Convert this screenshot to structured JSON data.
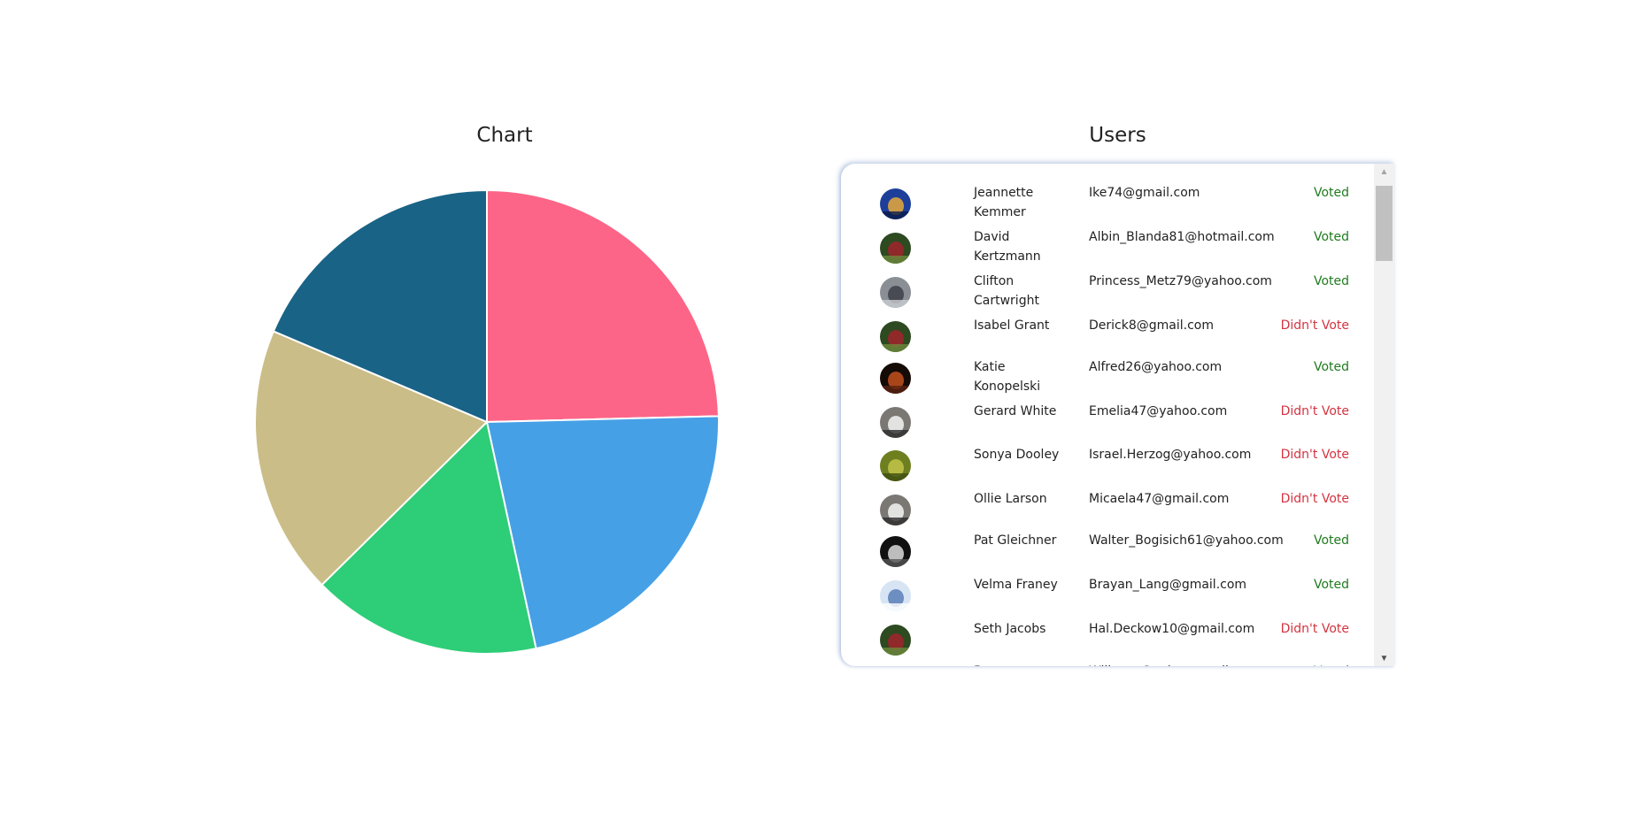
{
  "chart_section": {
    "title": "Chart"
  },
  "chart_data": {
    "type": "pie",
    "title": "Chart",
    "values": [
      24.6,
      22.0,
      16.0,
      18.8,
      18.6
    ],
    "colors": [
      "#fc6587",
      "#46a0e6",
      "#2ecd78",
      "#cbbd87",
      "#196386"
    ]
  },
  "users_section": {
    "title": "Users",
    "users": [
      {
        "name": "Jeannette Kemmer",
        "email": "Ike74@gmail.com",
        "status": "Voted",
        "voted": true,
        "avatar": "city-night"
      },
      {
        "name": "David Kertzmann",
        "email": "Albin_Blanda81@hotmail.com",
        "status": "Voted",
        "voted": true,
        "avatar": "garden"
      },
      {
        "name": "Clifton Cartwright",
        "email": "Princess_Metz79@yahoo.com",
        "status": "Voted",
        "voted": true,
        "avatar": "car"
      },
      {
        "name": "Isabel Grant",
        "email": "Derick8@gmail.com",
        "status": "Didn't Vote",
        "voted": false,
        "avatar": "garden"
      },
      {
        "name": "Katie Konopelski",
        "email": "Alfred26@yahoo.com",
        "status": "Voted",
        "voted": true,
        "avatar": "fox"
      },
      {
        "name": "Gerard White",
        "email": "Emelia47@yahoo.com",
        "status": "Didn't Vote",
        "voted": false,
        "avatar": "bird"
      },
      {
        "name": "Sonya Dooley",
        "email": "Israel.Herzog@yahoo.com",
        "status": "Didn't Vote",
        "voted": false,
        "avatar": "plant"
      },
      {
        "name": "Ollie Larson",
        "email": "Micaela47@gmail.com",
        "status": "Didn't Vote",
        "voted": false,
        "avatar": "bird"
      },
      {
        "name": "Pat Gleichner",
        "email": "Walter_Bogisich61@yahoo.com",
        "status": "Voted",
        "voted": true,
        "avatar": "tool"
      },
      {
        "name": "Velma Franey",
        "email": "Brayan_Lang@gmail.com",
        "status": "Voted",
        "voted": true,
        "avatar": "snow"
      },
      {
        "name": "Seth Jacobs",
        "email": "Hal.Deckow10@gmail.com",
        "status": "Didn't Vote",
        "voted": false,
        "avatar": "garden"
      },
      {
        "name": "Betty",
        "email": "Wilburn_Stroke@gmail.com",
        "status": "Voted",
        "voted": true,
        "avatar": "snow"
      }
    ]
  },
  "colors": {
    "voted": "#1e7b1e",
    "didnt_vote": "#d43340"
  }
}
